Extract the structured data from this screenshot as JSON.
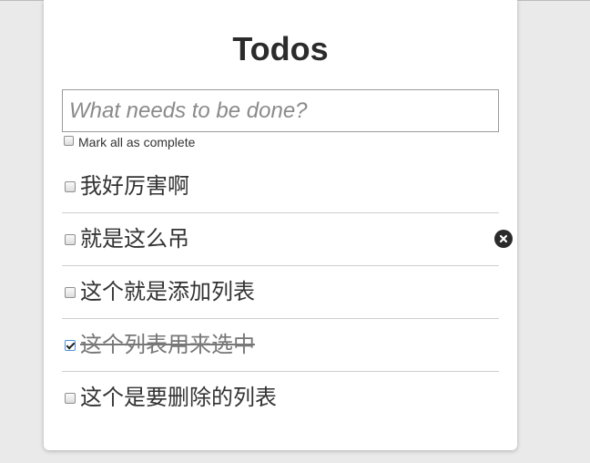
{
  "app": {
    "title": "Todos"
  },
  "new_todo": {
    "placeholder": "What needs to be done?",
    "value": ""
  },
  "toggle_all": {
    "label": "Mark all as complete",
    "checked": false
  },
  "todos": [
    {
      "text": "我好厉害啊",
      "completed": false
    },
    {
      "text": "就是这么吊",
      "completed": false
    },
    {
      "text": "这个就是添加列表",
      "completed": false
    },
    {
      "text": "这个列表用来选中",
      "completed": true
    },
    {
      "text": "这个是要删除的列表",
      "completed": false
    }
  ],
  "icons": {
    "destroy": "close-circle-icon"
  }
}
